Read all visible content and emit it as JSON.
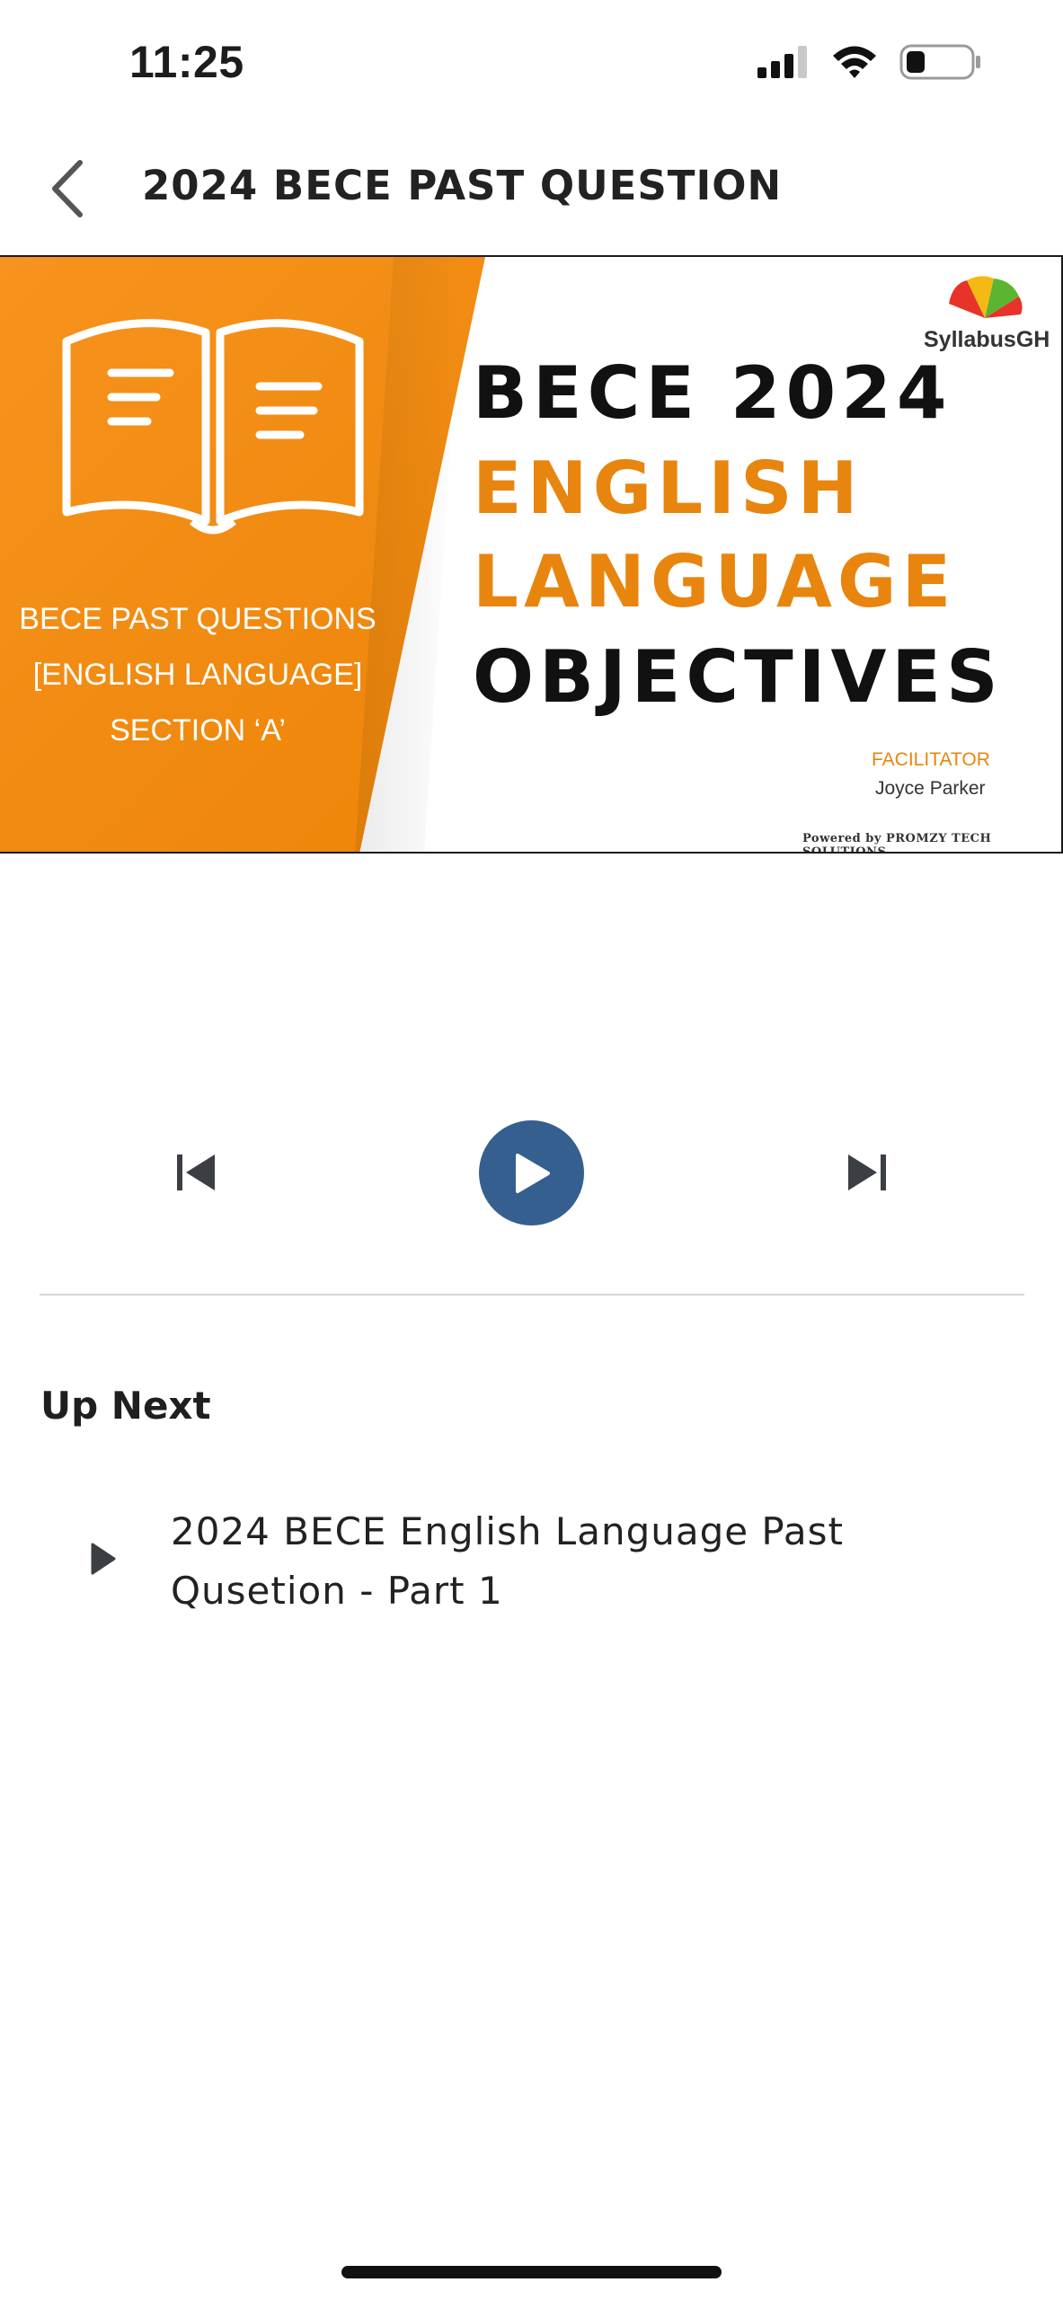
{
  "status_bar": {
    "time": "11:25",
    "icons": [
      "cellular-signal-icon",
      "wifi-icon",
      "battery-icon"
    ]
  },
  "header": {
    "title": "2024 BECE PAST QUESTION",
    "back_icon": "chevron-left-icon"
  },
  "banner": {
    "left_lines": [
      "BECE PAST QUESTIONS",
      "[ENGLISH LANGUAGE]",
      "SECTION ‘A’"
    ],
    "brand": "SyllabusGH",
    "headline_lines": [
      "BECE 2024",
      "ENGLISH",
      "LANGUAGE",
      "OBJECTIVES"
    ],
    "facilitator_label": "FACILITATOR",
    "facilitator_name": "Joyce Parker",
    "powered_by": "Powered by PROMZY TECH SOLUTIONS",
    "colors": {
      "orange": "#f08a10",
      "black": "#111111"
    }
  },
  "player": {
    "prev_icon": "skip-previous-icon",
    "play_icon": "play-icon",
    "next_icon": "skip-next-icon",
    "accent_color": "#345f8e"
  },
  "up_next": {
    "title": "Up Next",
    "items": [
      {
        "label": "2024 BECE English Language Past Qusetion - Part 1",
        "icon": "play-icon"
      }
    ]
  }
}
